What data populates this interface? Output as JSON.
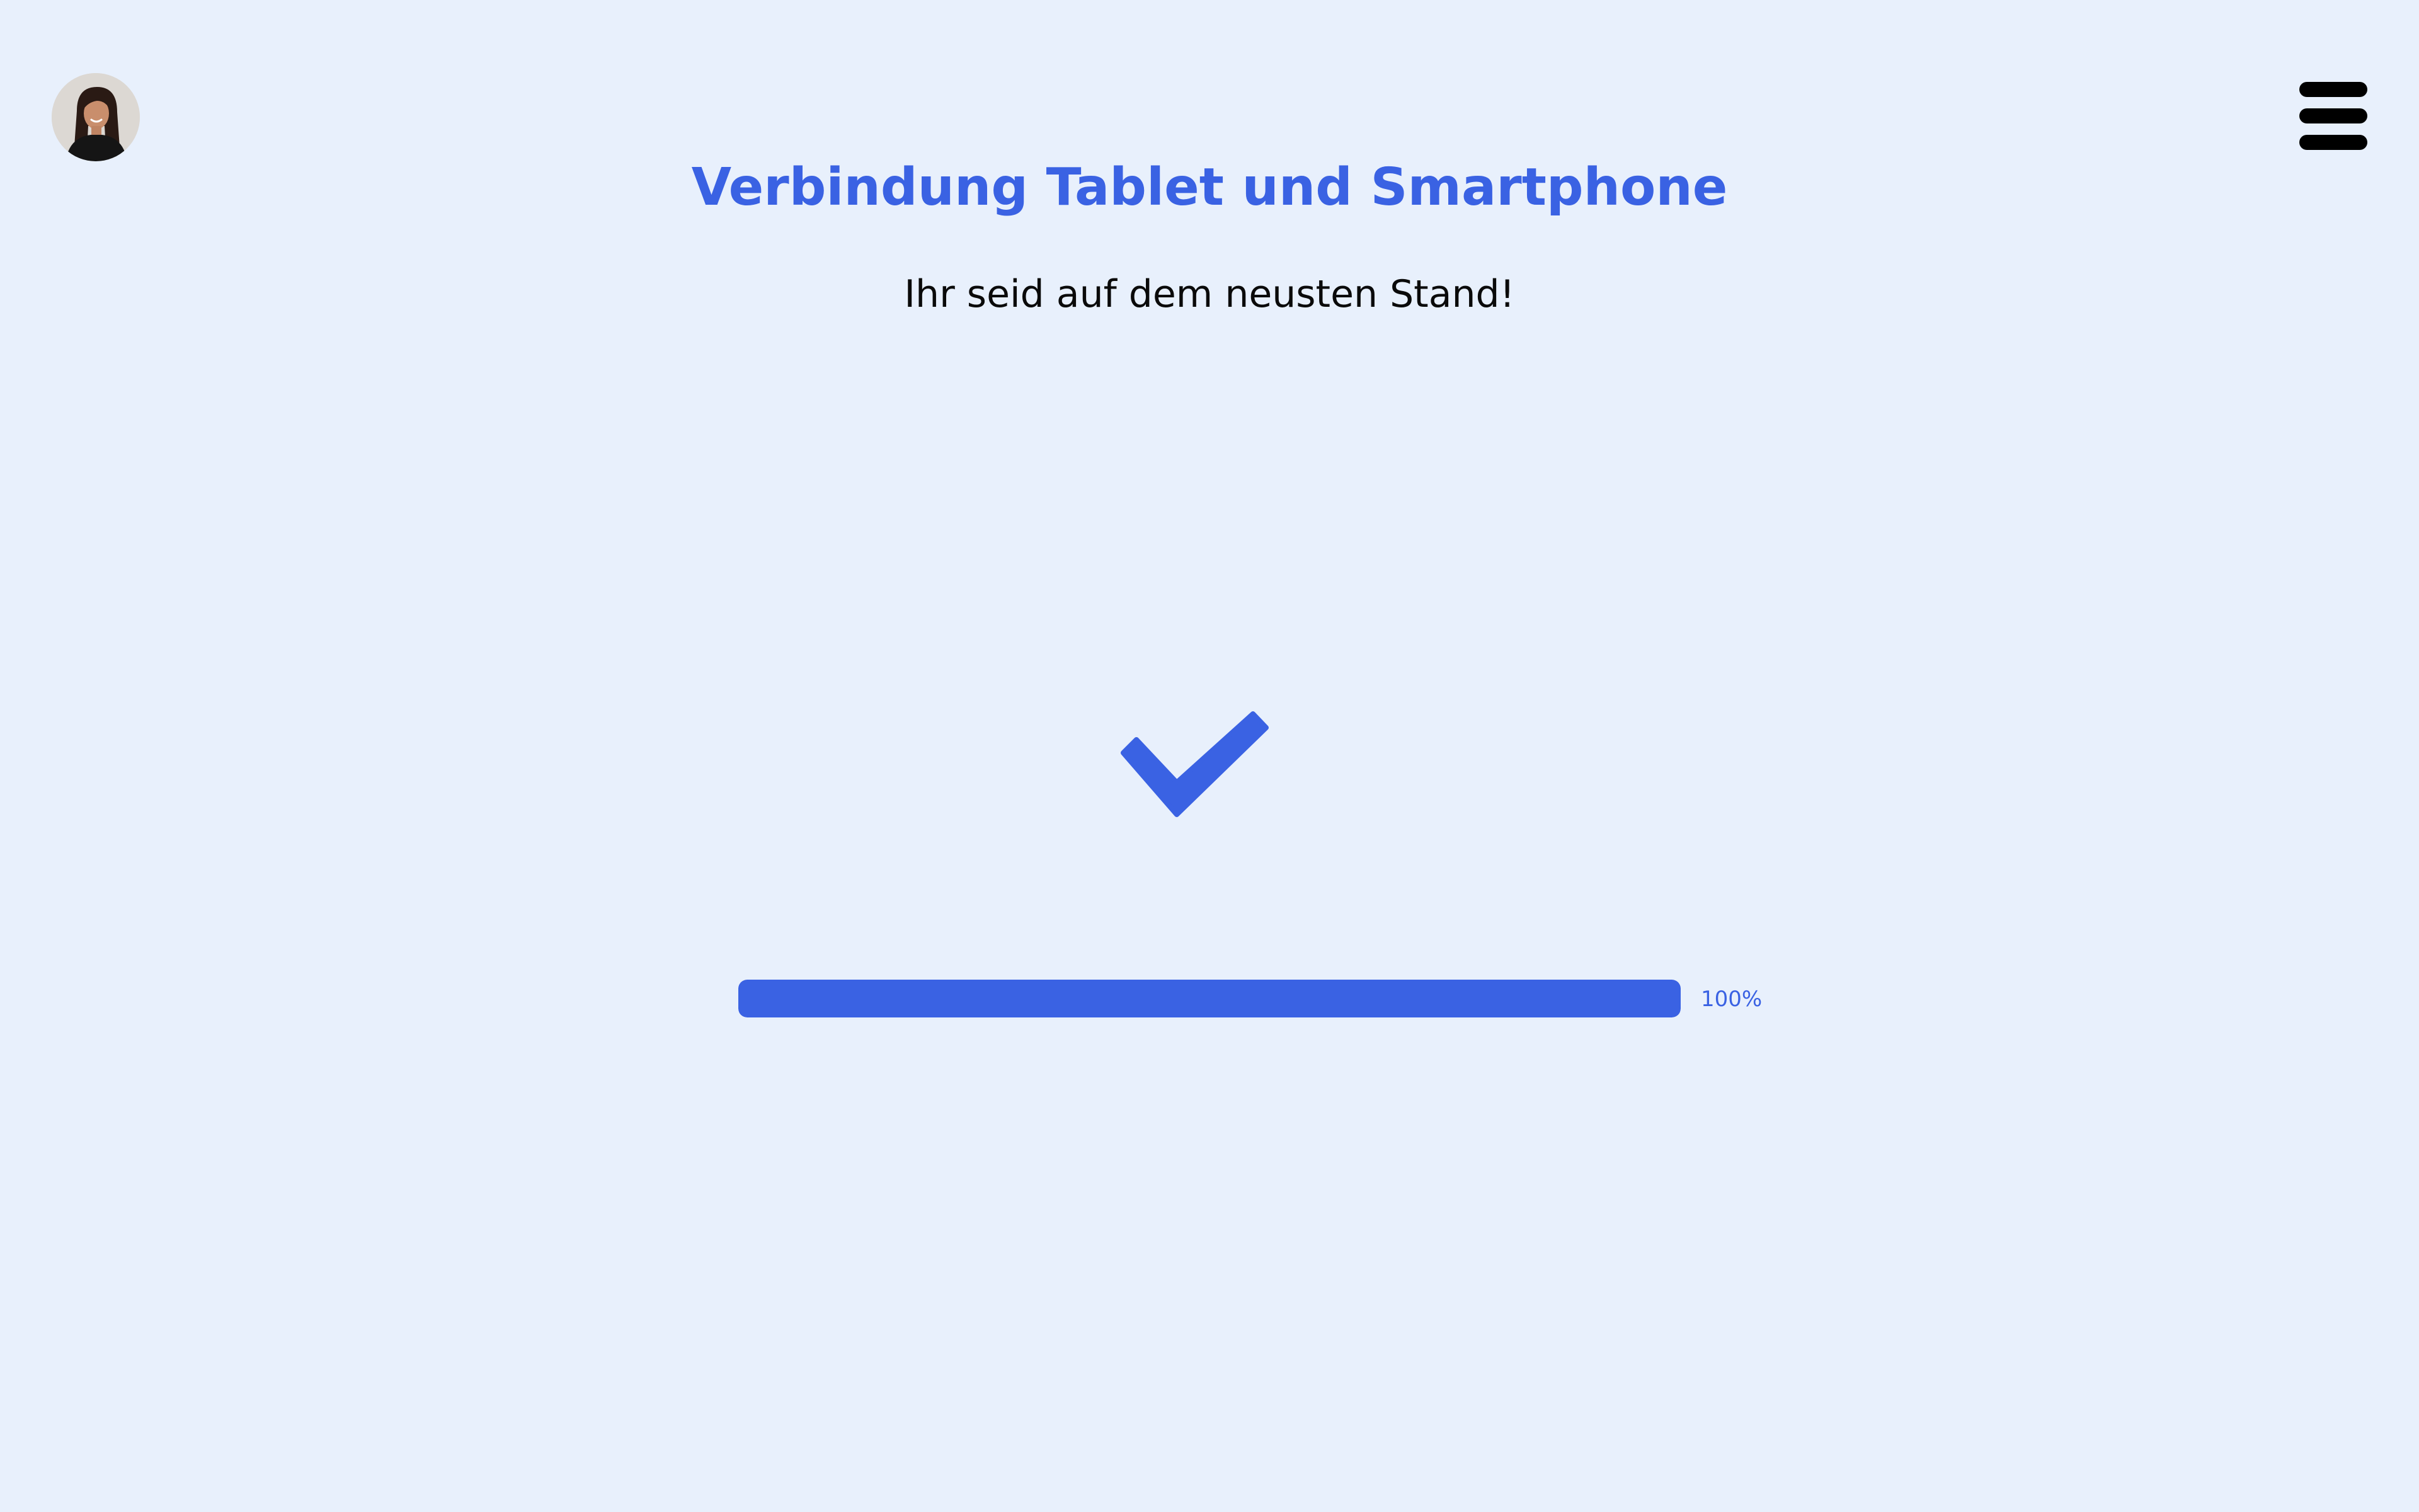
{
  "header": {
    "avatar_icon": "user-avatar-photo",
    "menu_icon": "hamburger-menu-icon"
  },
  "main": {
    "title": "Verbindung Tablet und Smartphone",
    "subtitle": "Ihr seid auf dem neusten Stand!",
    "status_icon": "checkmark-icon",
    "progress": {
      "value": 1.0,
      "label": "100%"
    }
  },
  "colors": {
    "accent": "#3a62e3",
    "background": "#e8f0fc",
    "text": "#0a0a0a"
  }
}
